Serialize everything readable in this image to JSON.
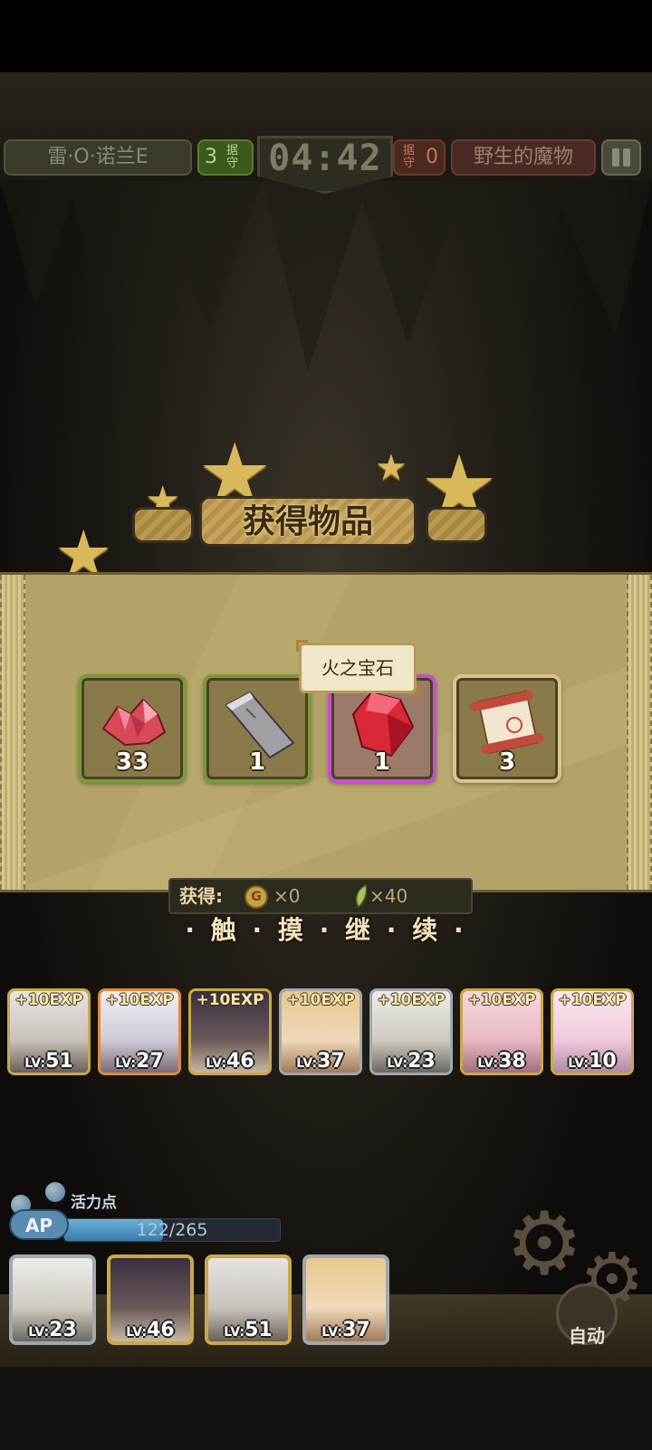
{
  "hud": {
    "team_left": "雷·O·诺兰E",
    "score_left": "3",
    "score_unit": "据守",
    "timer": "04:42",
    "score_right": "0",
    "team_right": "野生的魔物"
  },
  "title": "获得物品",
  "items": [
    {
      "count": "33",
      "icon": "pink-crystal-cluster-icon",
      "frame": "green"
    },
    {
      "count": "1",
      "icon": "iron-bar-icon",
      "frame": "green"
    },
    {
      "count": "1",
      "icon": "red-gem-icon",
      "frame": "purple"
    },
    {
      "count": "3",
      "icon": "scroll-icon",
      "frame": "tan"
    }
  ],
  "tooltip": "火之宝石",
  "rewards": {
    "label": "获得:",
    "gold_icon_letter": "G",
    "gold": "×0",
    "leaf": "×40"
  },
  "continue_text": "· 触 · 摸 · 继 · 续 ·",
  "party": [
    {
      "exp": "+10EXP",
      "level": "51"
    },
    {
      "exp": "+10EXP",
      "level": "27"
    },
    {
      "exp": "+10EXP",
      "level": "46"
    },
    {
      "exp": "+10EXP",
      "level": "37"
    },
    {
      "exp": "+10EXP",
      "level": "23"
    },
    {
      "exp": "+10EXP",
      "level": "38"
    },
    {
      "exp": "+10EXP",
      "level": "10"
    }
  ],
  "level_prefix": "LV:",
  "ap": {
    "badge": "AP",
    "label": "活力点",
    "value": "122/265",
    "fraction": 0.46
  },
  "deck": [
    {
      "level": "23"
    },
    {
      "level": "46"
    },
    {
      "level": "51"
    },
    {
      "level": "37"
    }
  ],
  "auto_label": "自动",
  "colors": {
    "panel": "#b4a368",
    "slot_green": "#7a9a3a",
    "slot_purple": "#c64ed0",
    "slot_tan": "#d8c48a",
    "ap_fill": "#4a92c0"
  }
}
